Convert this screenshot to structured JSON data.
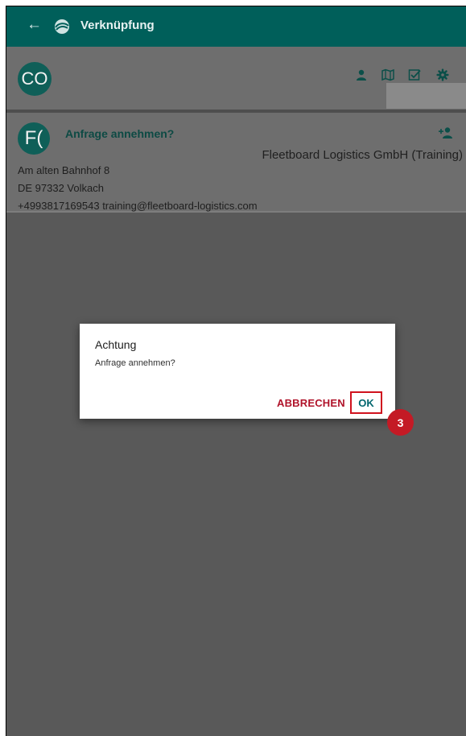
{
  "appbar": {
    "title": "Verknüpfung",
    "back_icon": "arrow-left-icon",
    "logo_icon": "app-logo-icon"
  },
  "header": {
    "avatar_initials": "CO",
    "icons": [
      "person-icon",
      "map-icon",
      "checkbox-icon",
      "gear-icon"
    ]
  },
  "card": {
    "avatar_initials": "F(",
    "title": "Anfrage annehmen?",
    "company": "Fleetboard Logistics GmbH (Training)",
    "address_line1": "Am alten Bahnhof 8",
    "address_line2": "DE 97332 Volkach",
    "contact": "+4993817169543 training@fleetboard-logistics.com",
    "action_icon": "add-person-icon"
  },
  "dialog": {
    "title": "Achtung",
    "message": "Anfrage annehmen?",
    "cancel_label": "ABBRECHEN",
    "ok_label": "OK"
  },
  "annotation": {
    "step_number": "3"
  },
  "colors": {
    "appbar": "#005f5a",
    "accent_teal": "#0f5f58",
    "cancel_red": "#b0132a",
    "highlight_red": "#d0121e"
  }
}
